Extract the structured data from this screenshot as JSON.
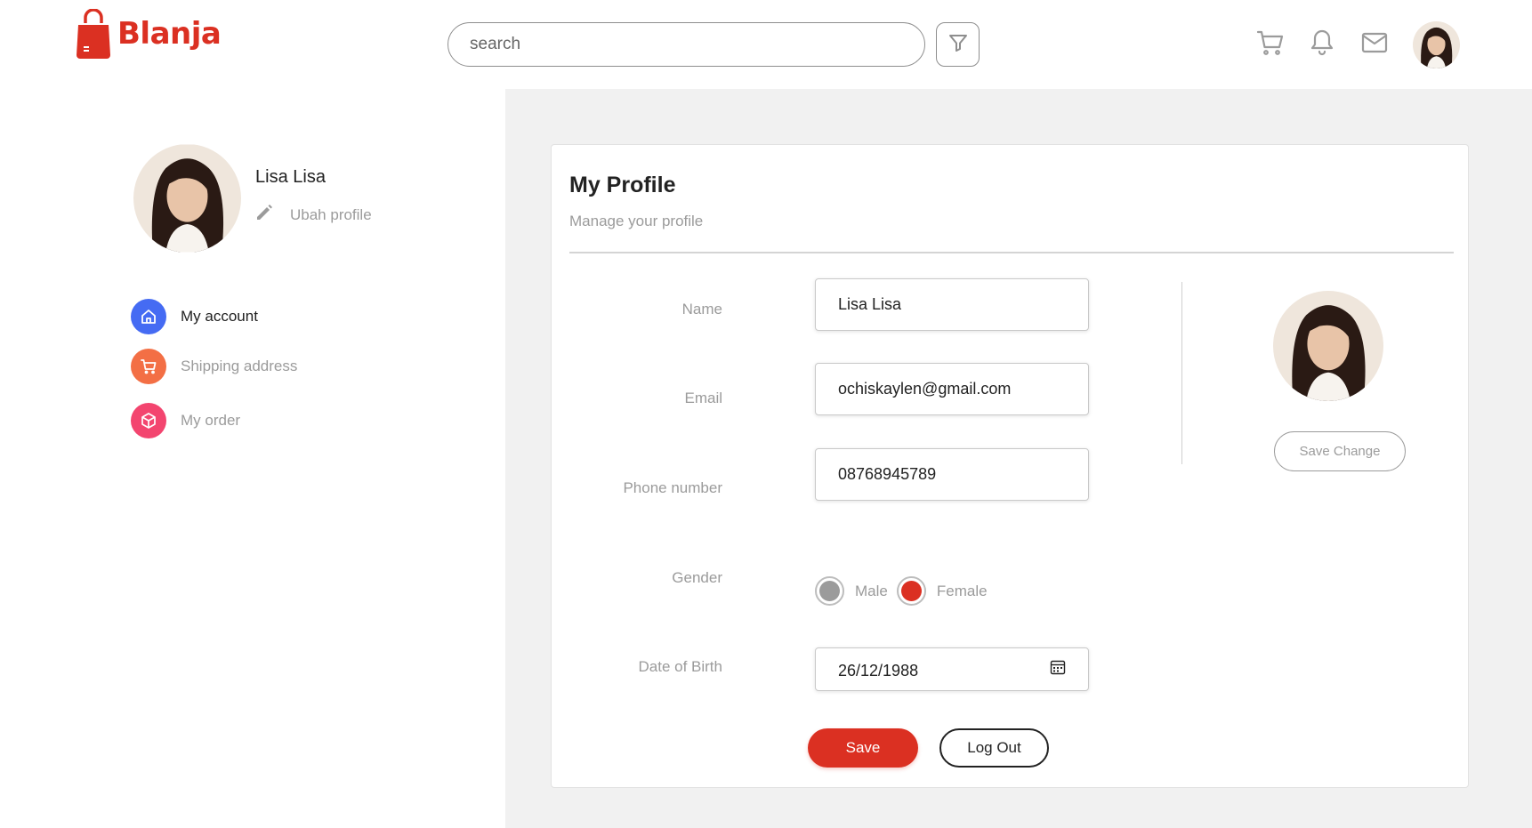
{
  "header": {
    "logo_text": "Blanja",
    "search_placeholder": "search",
    "icons": [
      "filter-icon",
      "cart-icon",
      "bell-icon",
      "mail-icon"
    ],
    "brand_color": "#DB3022"
  },
  "sidebar": {
    "user_name": "Lisa Lisa",
    "edit_label": "Ubah profile",
    "items": [
      {
        "label": "My account",
        "icon": "home-icon",
        "color": "#456BF3",
        "active": true
      },
      {
        "label": "Shipping address",
        "icon": "cart-icon",
        "color": "#F36F45",
        "active": false
      },
      {
        "label": "My order",
        "icon": "box-icon",
        "color": "#F3456F",
        "active": false
      }
    ]
  },
  "profile": {
    "title": "My Profile",
    "subtitle": "Manage your profile",
    "fields": {
      "name_label": "Name",
      "name_value": "Lisa Lisa",
      "email_label": "Email",
      "email_value": "ochiskaylen@gmail.com",
      "phone_label": "Phone number",
      "phone_value": "08768945789",
      "gender_label": "Gender",
      "gender_options": [
        "Male",
        "Female"
      ],
      "gender_selected": "Female",
      "dob_label": "Date of Birth",
      "dob_value": "26/12/1988"
    },
    "save_label": "Save",
    "logout_label": "Log Out",
    "save_change_label": "Save Change"
  }
}
